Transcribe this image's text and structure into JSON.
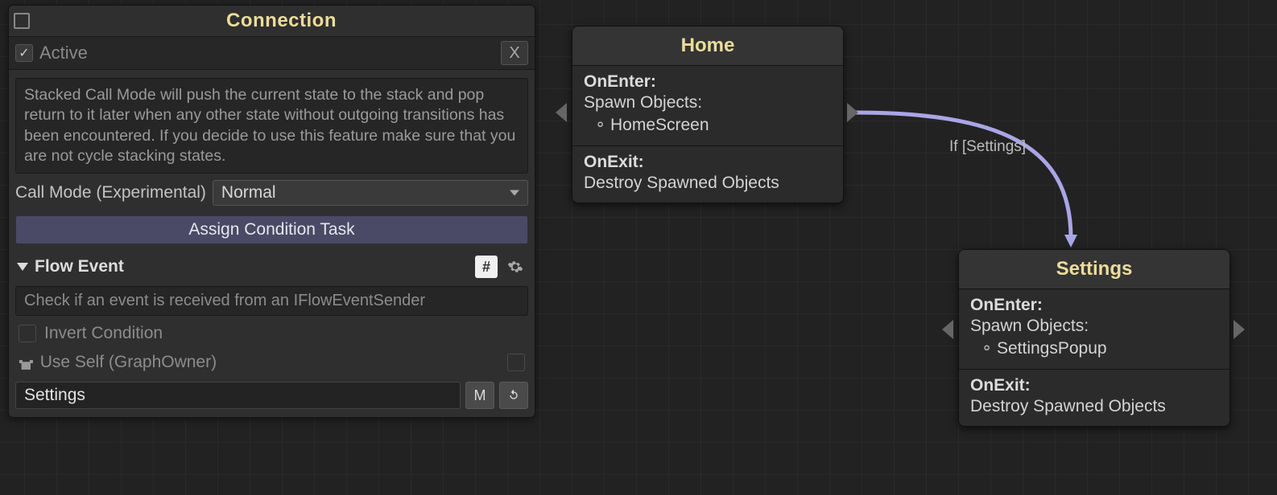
{
  "inspector": {
    "title": "Connection",
    "active_label": "Active",
    "active_checked": true,
    "close_label": "X",
    "description": "Stacked Call Mode will push the current state to the stack and pop return to it later when any other state without outgoing transitions has been encountered. If you decide to use this feature make sure that you are not cycle stacking states.",
    "call_mode_label": "Call Mode (Experimental)",
    "call_mode_value": "Normal",
    "assign_btn": "Assign Condition Task",
    "section_title": "Flow Event",
    "hash_btn": "#",
    "hint": "Check if an event is received from an IFlowEventSender",
    "invert_label": "Invert Condition",
    "use_self_label": "Use Self (GraphOwner)",
    "input_value": "Settings",
    "m_btn": "M"
  },
  "nodes": {
    "home": {
      "title": "Home",
      "on_enter_head": "OnEnter:",
      "on_enter_sub": "Spawn Objects:",
      "on_enter_item": "HomeScreen",
      "on_exit_head": "OnExit:",
      "on_exit_line": "Destroy Spawned Objects"
    },
    "settings": {
      "title": "Settings",
      "on_enter_head": "OnEnter:",
      "on_enter_sub": "Spawn Objects:",
      "on_enter_item": "SettingsPopup",
      "on_exit_head": "OnExit:",
      "on_exit_line": "Destroy Spawned Objects"
    }
  },
  "edge": {
    "label": "If [Settings]"
  }
}
